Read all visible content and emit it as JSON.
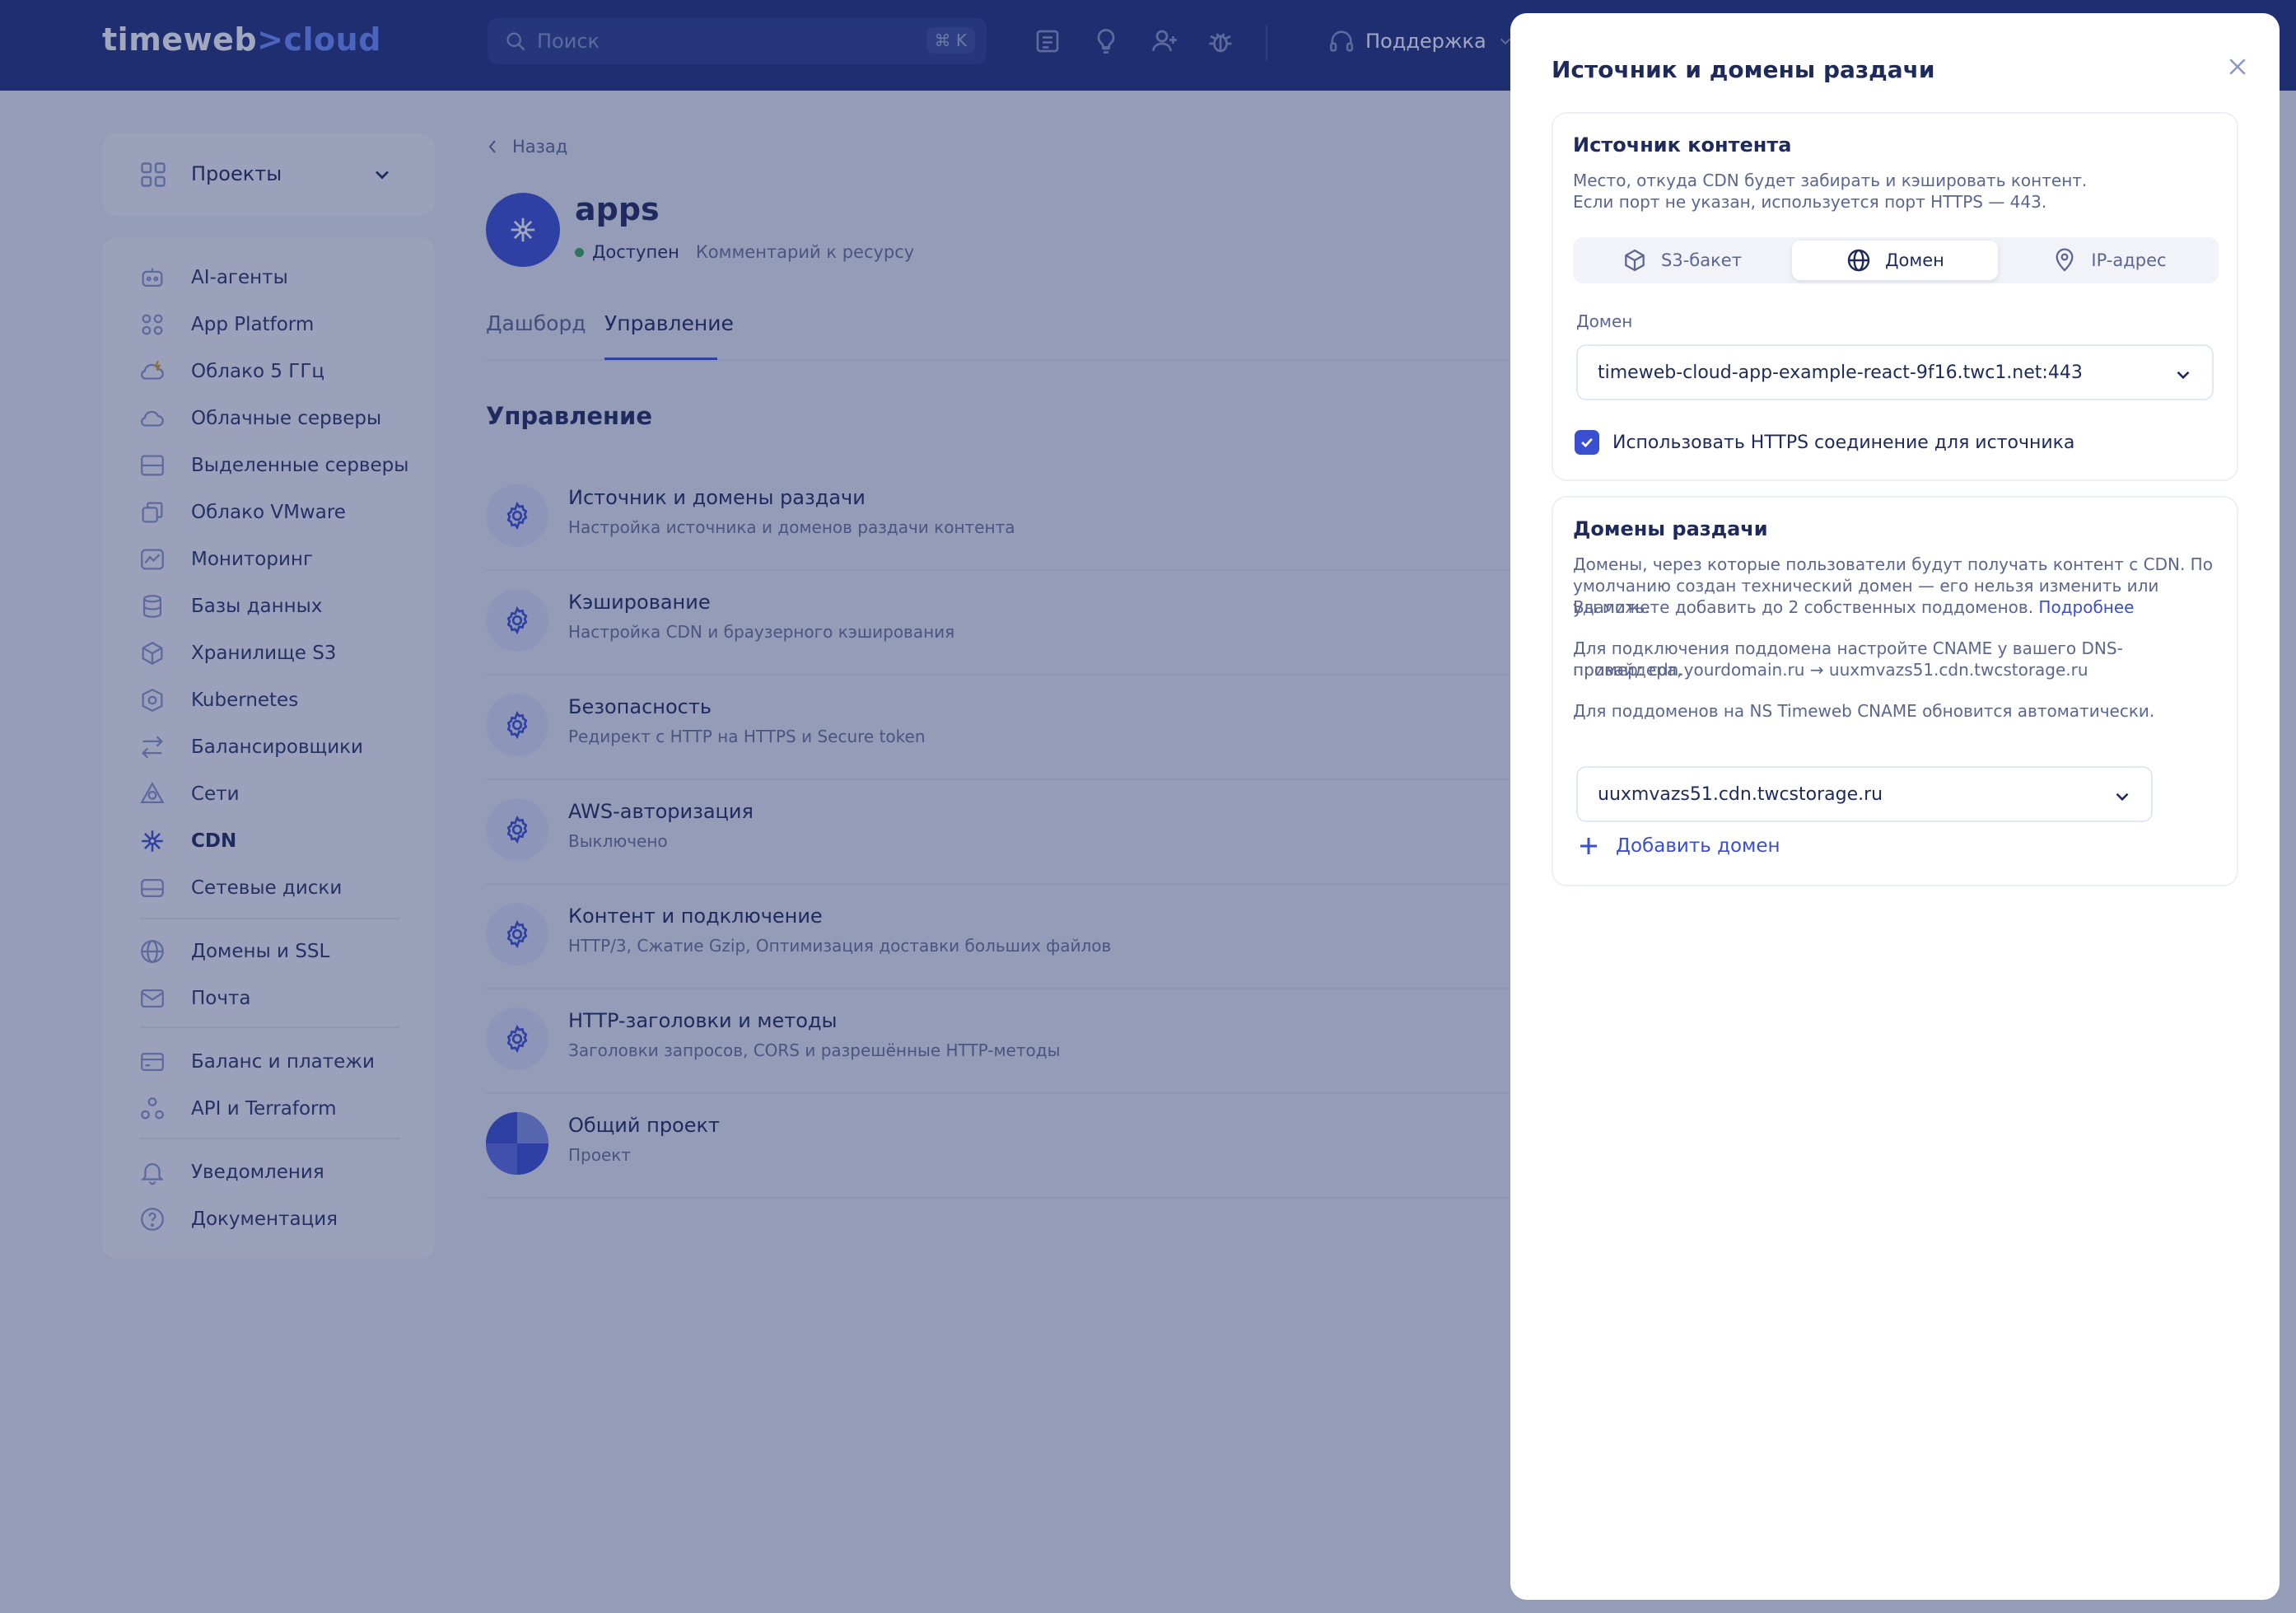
{
  "header": {
    "logo_main": "timeweb",
    "logo_accent": ">cloud",
    "search_placeholder": "Поиск",
    "search_shortcut": "⌘ K",
    "support_label": "Поддержка"
  },
  "sidebar": {
    "projects_label": "Проекты",
    "items": [
      {
        "label": "AI-агенты",
        "icon": "robot-icon"
      },
      {
        "label": "App Platform",
        "icon": "apps-grid-icon"
      },
      {
        "label": "Облако 5 ГГц",
        "icon": "cloud-bolt-icon"
      },
      {
        "label": "Облачные серверы",
        "icon": "cloud-icon"
      },
      {
        "label": "Выделенные серверы",
        "icon": "server-icon"
      },
      {
        "label": "Облако VMware",
        "icon": "vmware-icon"
      },
      {
        "label": "Мониторинг",
        "icon": "monitoring-icon"
      },
      {
        "label": "Базы данных",
        "icon": "database-icon"
      },
      {
        "label": "Хранилище S3",
        "icon": "cube-icon"
      },
      {
        "label": "Kubernetes",
        "icon": "kubernetes-icon"
      },
      {
        "label": "Балансировщики",
        "icon": "balancer-icon"
      },
      {
        "label": "Сети",
        "icon": "network-icon"
      },
      {
        "label": "CDN",
        "icon": "cdn-icon"
      },
      {
        "label": "Сетевые диски",
        "icon": "disk-icon"
      },
      {
        "label": "Домены и SSL",
        "icon": "globe-icon"
      },
      {
        "label": "Почта",
        "icon": "mail-icon"
      },
      {
        "label": "Баланс и платежи",
        "icon": "wallet-icon"
      },
      {
        "label": "API и Terraform",
        "icon": "api-icon"
      },
      {
        "label": "Уведомления",
        "icon": "bell-icon"
      },
      {
        "label": "Документация",
        "icon": "help-icon"
      }
    ]
  },
  "main": {
    "back_label": "Назад",
    "app_name": "apps",
    "status": "Доступен",
    "comment": "Комментарий к ресурсу",
    "tabs": [
      "Дашборд",
      "Управление"
    ],
    "section_title": "Управление",
    "rows": [
      {
        "title": "Источник и домены раздачи",
        "subtitle": "Настройка источника и доменов раздачи контента"
      },
      {
        "title": "Кэширование",
        "subtitle": "Настройка CDN и браузерного кэширования"
      },
      {
        "title": "Безопасность",
        "subtitle": "Редирект с HTTP на HTTPS и Secure token"
      },
      {
        "title": "AWS-авторизация",
        "subtitle": "Выключено"
      },
      {
        "title": "Контент и подключение",
        "subtitle": "HTTP/3, Сжатие Gzip, Оптимизация доставки больших файлов"
      },
      {
        "title": "HTTP-заголовки и методы",
        "subtitle": "Заголовки запросов, CORS и разрешённые HTTP-методы"
      },
      {
        "title": "Общий проект",
        "subtitle": "Проект"
      }
    ]
  },
  "modal": {
    "title": "Источник и домены раздачи",
    "source": {
      "heading": "Источник контента",
      "desc_line1": "Место, откуда CDN будет забирать и кэшировать контент.",
      "desc_line2": "Если порт не указан, используется порт HTTPS — 443.",
      "options": [
        "S3-бакет",
        "Домен",
        "IP-адрес"
      ],
      "selected_option": "Домен",
      "field_label": "Домен",
      "field_value": "timeweb-cloud-app-example-react-9f16.twc1.net:443",
      "https_checkbox_label": "Использовать HTTPS соединение для источника",
      "https_checked": true
    },
    "domains": {
      "heading": "Домены раздачи",
      "p1_line1": "Домены, через которые пользователи будут получать контент с CDN. По",
      "p1_line2": "умолчанию создан технический домен — его нельзя изменить или удалить.",
      "p1_line3": "Вы можете добавить до 2 собственных поддоменов.",
      "p1_link": "Подробнее",
      "p2_line1": "Для подключения поддомена настройте CNAME у вашего DNS-провайдера,",
      "p2_line2": "пример: cdn.yourdomain.ru → uuxmvazs51.cdn.twcstorage.ru",
      "p3": "Для поддоменов на NS Timeweb CNAME обновится автоматически.",
      "domain_value": "uuxmvazs51.cdn.twcstorage.ru",
      "add_label": "Добавить домен"
    }
  },
  "colors": {
    "header_bg": "#1e2f7a",
    "accent": "#3a4fd0",
    "status_green": "#3aa655"
  }
}
